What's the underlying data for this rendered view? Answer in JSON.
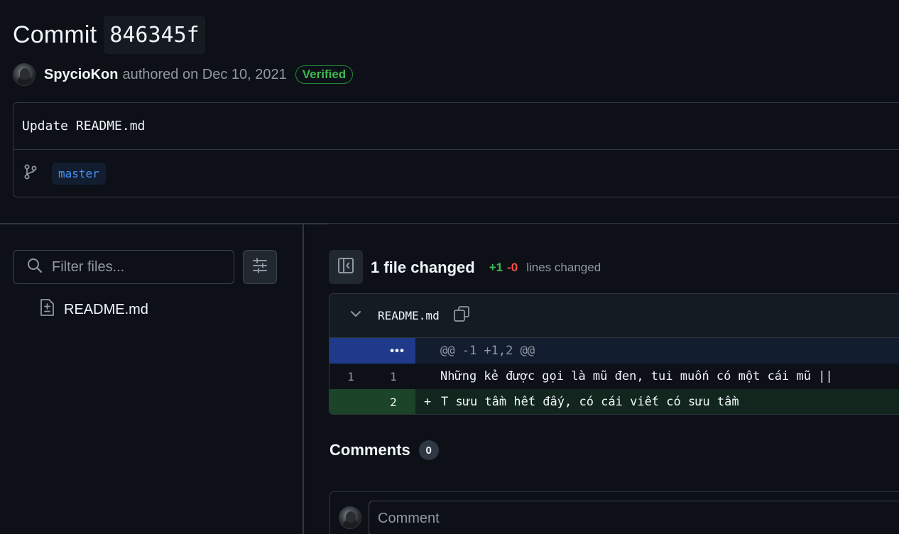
{
  "header": {
    "title_word": "Commit",
    "sha": "846345f"
  },
  "author": {
    "name": "SpycioKon",
    "meta": "authored on Dec 10, 2021",
    "badge": "Verified"
  },
  "commit": {
    "message": "Update README.md",
    "branch": "master"
  },
  "sidebar": {
    "filter_placeholder": "Filter files...",
    "files": [
      "README.md"
    ]
  },
  "summary": {
    "title": "1 file changed",
    "additions": "+1",
    "deletions": "-0",
    "suffix": "lines changed"
  },
  "diff": {
    "filename": "README.md",
    "hunk_expand": "•••",
    "hunk_header": "@@ -1 +1,2 @@",
    "rows": [
      {
        "old": "1",
        "new": "1",
        "sign": "",
        "text": "Những kẻ được gọi là mũ đen, tui muốn có một cái mũ ||"
      },
      {
        "old": "",
        "new": "2",
        "sign": "+",
        "text": "T sưu tầm hết đấy, có cái viết có sưu tầm"
      }
    ]
  },
  "comments": {
    "title": "Comments",
    "count": "0",
    "placeholder": "Comment"
  },
  "colors": {
    "background": "#0d1117",
    "addition": "#3fb950",
    "deletion": "#f85149",
    "link": "#4493f8"
  }
}
